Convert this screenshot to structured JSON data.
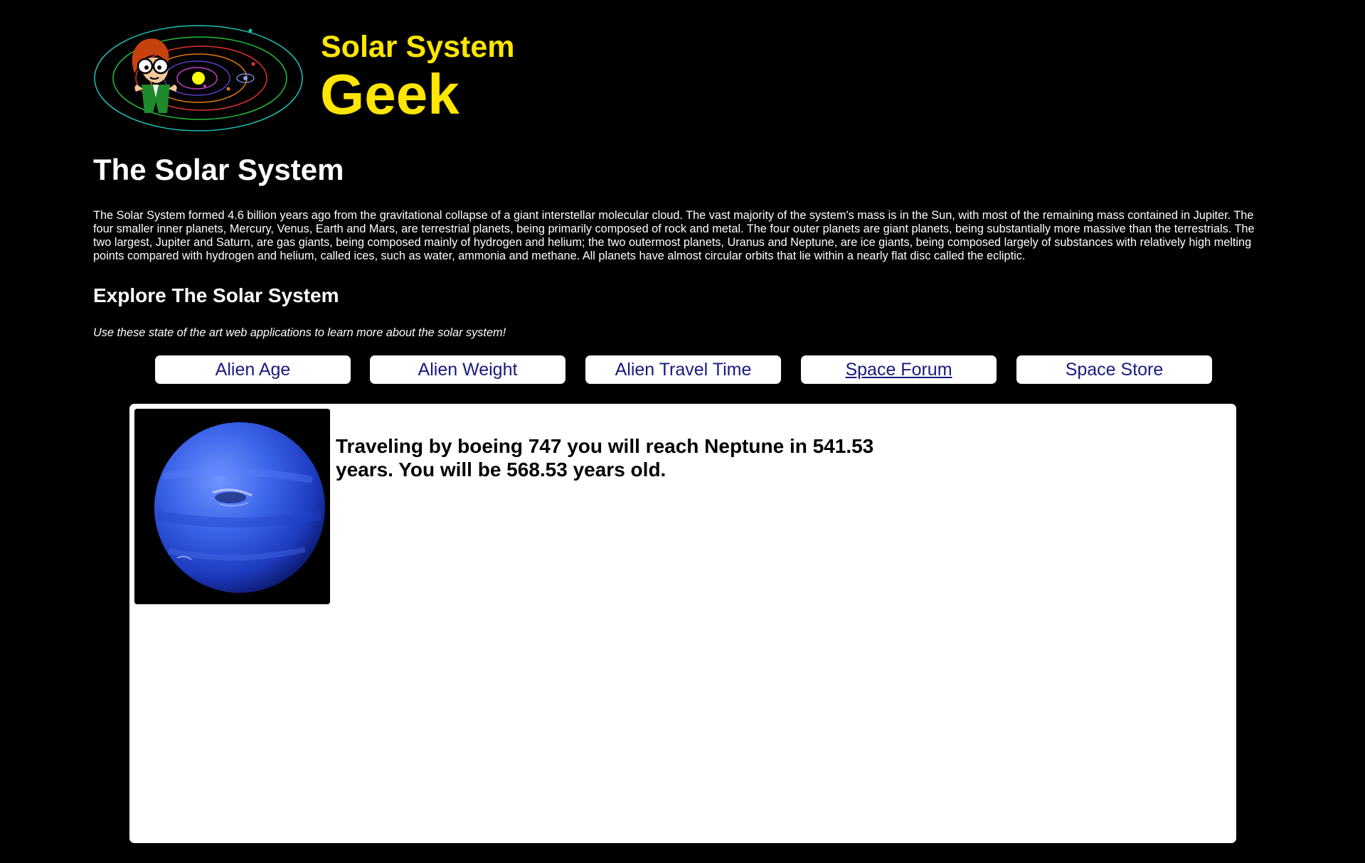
{
  "brand": {
    "line1": "Solar System",
    "line2": "Geek"
  },
  "page_title": "The Solar System",
  "intro": "The Solar System formed 4.6 billion years ago from the gravitational collapse of a giant interstellar molecular cloud. The vast majority of the system's mass is in the Sun, with most of the remaining mass contained in Jupiter. The four smaller inner planets, Mercury, Venus, Earth and Mars, are terrestrial planets, being primarily composed of rock and metal. The four outer planets are giant planets, being substantially more massive than the terrestrials. The two largest, Jupiter and Saturn, are gas giants, being composed mainly of hydrogen and helium; the two outermost planets, Uranus and Neptune, are ice giants, being composed largely of substances with relatively high melting points compared with hydrogen and helium, called ices, such as water, ammonia and methane. All planets have almost circular orbits that lie within a nearly flat disc called the ecliptic.",
  "explore": {
    "title": "Explore The Solar System",
    "subtitle": "Use these state of the art web applications to learn more about the solar system!"
  },
  "nav": {
    "items": [
      {
        "label": "Alien Age"
      },
      {
        "label": "Alien Weight"
      },
      {
        "label": "Alien Travel Time"
      },
      {
        "label": "Space Forum"
      },
      {
        "label": "Space Store"
      }
    ]
  },
  "result": {
    "text": "Traveling by boeing 747 you will reach Neptune in 541.53 years. You will be 568.53 years old."
  },
  "colors": {
    "background": "#000000",
    "brand": "#ffe600",
    "link": "#1a1a80",
    "panel": "#ffffff"
  },
  "icons": {
    "logo": "solar-system-geek-logo-icon",
    "planet": "neptune-planet-image"
  }
}
